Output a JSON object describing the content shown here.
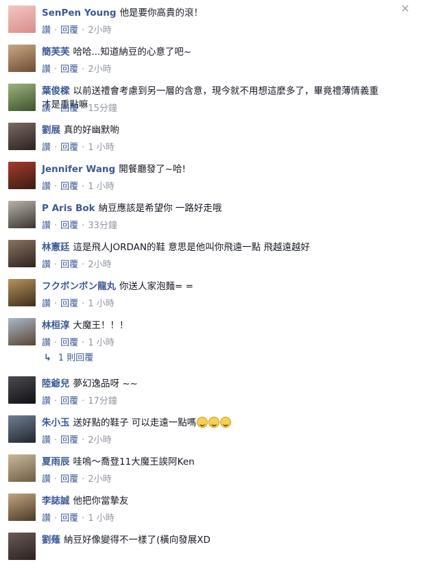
{
  "ui": {
    "like_label": "讚",
    "reply_label": "回覆",
    "separator": "·"
  },
  "comments": [
    {
      "author": "SenPen Young",
      "text": "他是要你高貴的滾！",
      "time": "2小時",
      "avatar_colors": [
        "#f4c6c2",
        "#d88e8a"
      ]
    },
    {
      "author": "簡芙芙",
      "text": "哈哈...知道納豆的心意了吧~",
      "time": "2小時",
      "avatar_colors": [
        "#c9a884",
        "#6d4c33"
      ]
    },
    {
      "author": "葉俊樑",
      "text": "以前送禮會考慮到另一層的含意，現今就不用想這麼多了，畢竟禮薄情義重才是重點嘛",
      "time": "15分鐘",
      "avatar_colors": [
        "#9bb47d",
        "#40522c"
      ]
    },
    {
      "author": "劉展",
      "text": "真的好幽默喲",
      "time": "1 小時",
      "avatar_colors": [
        "#7b6a63",
        "#2a2220"
      ]
    },
    {
      "author": "Jennifer Wang",
      "text": "開餐廳發了~哈!",
      "time": "1 小時",
      "avatar_colors": [
        "#a53a2c",
        "#3b1d12"
      ]
    },
    {
      "author": "P Aris Bok",
      "text": "納豆應該是希望你 一路好走哦",
      "time": "33分鐘",
      "avatar_colors": [
        "#b9b3aa",
        "#3a3531"
      ]
    },
    {
      "author": "林憲廷",
      "text": "這是飛人JORDAN的鞋 意思是他叫你飛遠一點 飛越遠越好",
      "time": "2小時",
      "avatar_colors": [
        "#8a7261",
        "#2d241f"
      ]
    },
    {
      "author": "フクボンボン龍丸",
      "text": "你送人家泡麵= =",
      "time": "1 小時",
      "avatar_colors": [
        "#b4925d",
        "#3e2e1b"
      ]
    },
    {
      "author": "林桓淳",
      "text": "大魔王！！！",
      "time": "1 小時",
      "avatar_colors": [
        "#a9b8c9",
        "#5a4531"
      ]
    }
  ],
  "replies_link": {
    "arrow": "↳",
    "label": "1 則回覆"
  },
  "comments_after": [
    {
      "author": "陸爺兒",
      "text": "夢幻逸品呀 ~~",
      "time": "17分鐘",
      "avatar_colors": [
        "#4a4a52",
        "#111114"
      ]
    },
    {
      "author": "朱小玉",
      "text": "送好點的鞋子 可以走遠一點嗎",
      "time": "2小時",
      "avatar_colors": [
        "#6f7f94",
        "#22262d"
      ],
      "emoji_count": 3
    },
    {
      "author": "夏雨辰",
      "text": "哇嗚～喬登11大魔王誒阿Ken",
      "time": "2小時",
      "avatar_colors": [
        "#c9b89a",
        "#6e5d45"
      ]
    },
    {
      "author": "李誌誠",
      "text": "他把你當摯友",
      "time": "1 小時",
      "avatar_colors": [
        "#c4a380",
        "#4a3a2a"
      ]
    },
    {
      "author": "劉薙",
      "text": "納豆好像變得不一樣了(橫向發展XD",
      "time": "",
      "avatar_colors": [
        "#6a5a55",
        "#2a2220"
      ]
    }
  ]
}
